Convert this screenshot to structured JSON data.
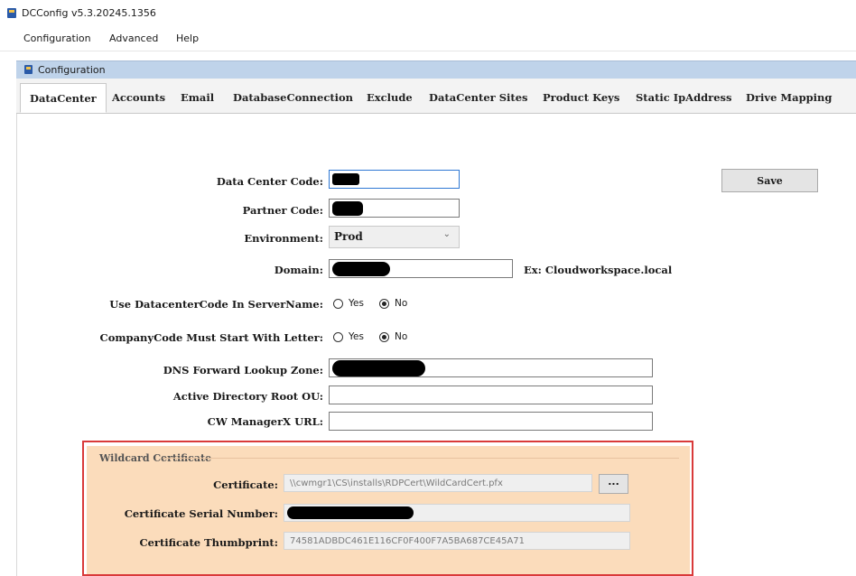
{
  "app": {
    "title": "DCConfig v5.3.20245.1356"
  },
  "menu": [
    "Configuration",
    "Advanced",
    "Help"
  ],
  "mdi": {
    "title": "Configuration"
  },
  "tabs": [
    "DataCenter",
    "Accounts",
    "Email",
    "DatabaseConnection",
    "Exclude",
    "DataCenter Sites",
    "Product Keys",
    "Static IpAddress",
    "Drive Mapping"
  ],
  "form": {
    "datacenter_code_label": "Data Center Code:",
    "partner_code_label": "Partner Code:",
    "environment_label": "Environment:",
    "environment_value": "Prod",
    "domain_label": "Domain:",
    "domain_hint": "Ex: Cloudworkspace.local",
    "use_dc_code_label": "Use DatacenterCode In ServerName:",
    "use_dc_code_options": [
      "Yes",
      "No"
    ],
    "use_dc_code_selected": "No",
    "company_code_label": "CompanyCode Must Start With Letter:",
    "company_code_options": [
      "Yes",
      "No"
    ],
    "company_code_selected": "No",
    "dns_zone_label": "DNS Forward Lookup Zone:",
    "ad_root_ou_label": "Active Directory Root OU:",
    "ad_root_ou_value": "",
    "cw_managerx_url_label": "CW ManagerX URL:",
    "cw_managerx_url_value": ""
  },
  "buttons": {
    "save": "Save"
  },
  "cert": {
    "group_title": "Wildcard Certificate",
    "certificate_label": "Certificate:",
    "certificate_value": "\\\\cwmgr1\\CS\\installs\\RDPCert\\WildCardCert.pfx",
    "browse_label": "...",
    "serial_label": "Certificate Serial Number:",
    "thumbprint_label": "Certificate Thumbprint:",
    "thumbprint_value": "74581ADBDC461E116CF0F400F7A5BA687CE45A71"
  },
  "colors": {
    "highlight_border": "#d93a3a",
    "group_background": "#fbdcbb",
    "focus_border": "#2f78d4"
  }
}
